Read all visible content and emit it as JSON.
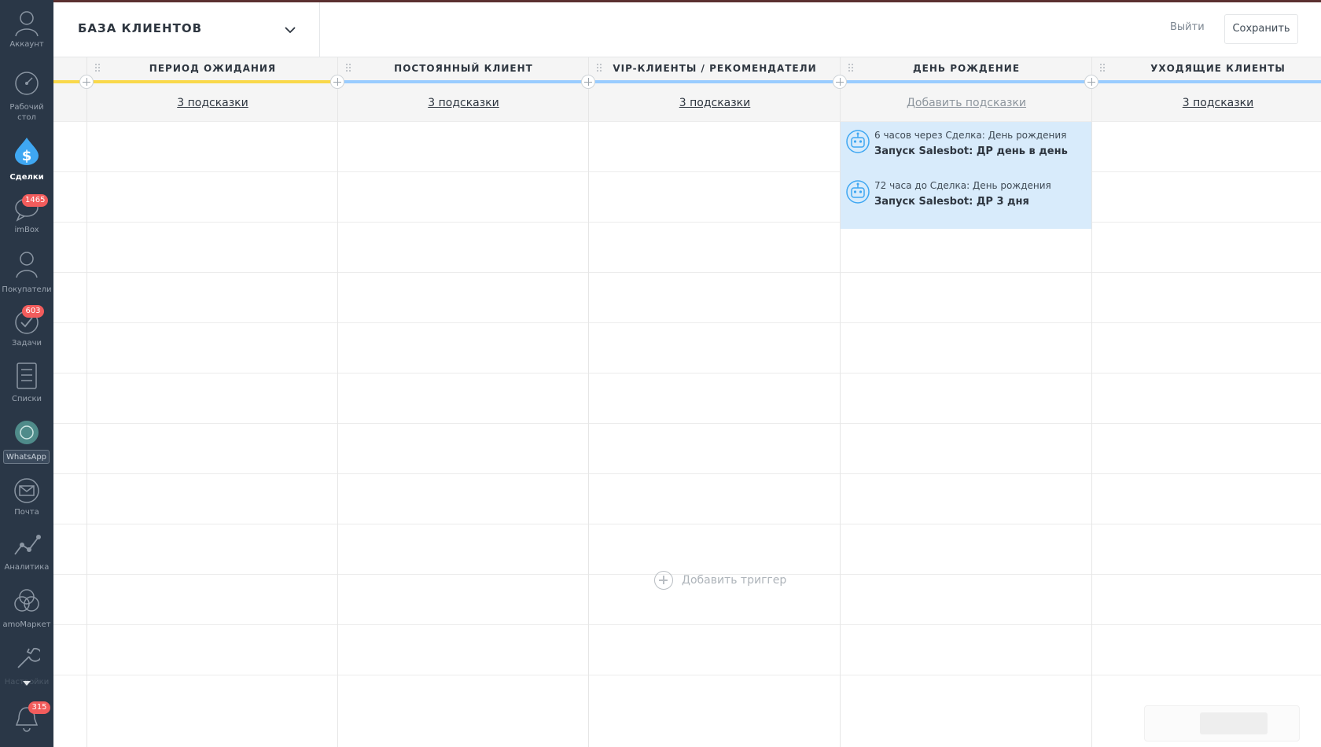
{
  "sidebar": {
    "items": [
      {
        "label": "Аккаунт",
        "icon": "user-icon"
      },
      {
        "label": "Рабочий стол",
        "icon": "dashboard-icon"
      },
      {
        "label": "Сделки",
        "icon": "deals-dollar-icon"
      },
      {
        "label": "imBox",
        "icon": "chat-icon",
        "badge": "1465"
      },
      {
        "label": "Покупатели",
        "icon": "customers-icon"
      },
      {
        "label": "Задачи",
        "icon": "tasks-check-icon",
        "badge": "603"
      },
      {
        "label": "Списки",
        "icon": "lists-icon"
      },
      {
        "label": "WhatsApp \\",
        "icon": "whatsapp-icon"
      },
      {
        "label": "Почта",
        "icon": "mail-icon"
      },
      {
        "label": "Аналитика",
        "icon": "analytics-icon"
      },
      {
        "label": "amoМаркет",
        "icon": "market-icon"
      },
      {
        "label": "Настройки",
        "icon": "settings-wrench-icon"
      },
      {
        "label": "",
        "icon": "notifications-bell-icon",
        "badge": "315"
      }
    ],
    "active": "Сделки"
  },
  "header": {
    "pipeline_title": "БАЗА КЛИЕНТОВ",
    "exit_label": "Выйти",
    "save_label": "Сохранить"
  },
  "stages": [
    {
      "title": "ПЕРИОД ОЖИДАНИЯ",
      "color": "#f9d84a",
      "hints": "3 подсказки"
    },
    {
      "title": "ПОСТОЯННЫЙ КЛИЕНТ",
      "color": "#99ccff",
      "hints": "3 подсказки"
    },
    {
      "title": "VIP-КЛИЕНТЫ / РЕКОМЕНДАТЕЛИ",
      "color": "#99ccff",
      "hints": "3 подсказки"
    },
    {
      "title": "ДЕНЬ РОЖДЕНИЕ",
      "color": "#99ccff",
      "hints": "Добавить подсказки"
    },
    {
      "title": "УХОДЯЩИЕ КЛИЕНТЫ",
      "color": "#99ccff",
      "hints": "3 подсказки"
    }
  ],
  "triggers": [
    {
      "when": "6 часов через Сделка: День рождения",
      "action": "Запуск Salesbot: ДР день в день"
    },
    {
      "when": "72 часа до Сделка: День рождения",
      "action": "Запуск Salesbot: ДР 3 дня"
    }
  ],
  "add_trigger_label": "Добавить триггер",
  "colors": {
    "sidebar_bg": "#2a3747",
    "trigger_bg": "#d8ebfb",
    "badge": "#f25c5c"
  }
}
